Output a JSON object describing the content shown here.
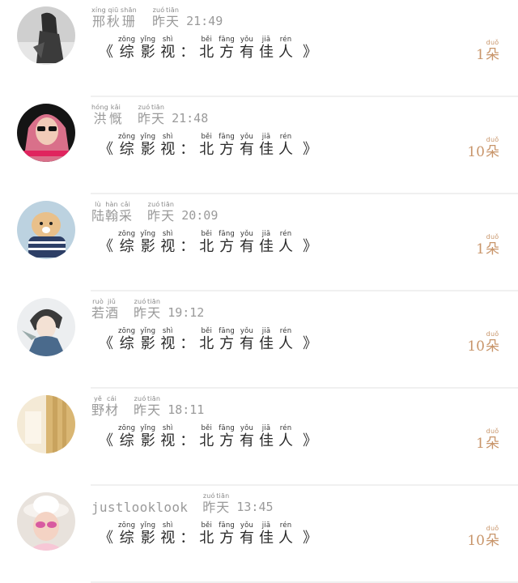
{
  "colors": {
    "text_gray": "#9a9a9a",
    "text_dark": "#2a2a2a",
    "amount_accent": "#c8956a",
    "divider": "#f0f0f0"
  },
  "shared": {
    "day_label": {
      "pinyin": [
        "zuó",
        "tiān"
      ],
      "chars": [
        "昨",
        "天"
      ]
    },
    "title": {
      "open": "《",
      "close": "》",
      "colon": "：",
      "chars1": [
        {
          "py": "zōng",
          "ch": "综"
        },
        {
          "py": "yǐng",
          "ch": "影"
        },
        {
          "py": "shì",
          "ch": "视"
        }
      ],
      "chars2": [
        {
          "py": "běi",
          "ch": "北"
        },
        {
          "py": "fāng",
          "ch": "方"
        },
        {
          "py": "yǒu",
          "ch": "有"
        },
        {
          "py": "jiā",
          "ch": "佳"
        },
        {
          "py": "rén",
          "ch": "人"
        }
      ]
    },
    "unit": {
      "py": "duǒ",
      "ch": "朵"
    }
  },
  "rows": [
    {
      "avatar_icon": "avatar-girl-gray-icon",
      "name_chars": [
        {
          "py": "xíng",
          "ch": "邢"
        },
        {
          "py": "qiū",
          "ch": "秋"
        },
        {
          "py": "shān",
          "ch": "珊"
        }
      ],
      "time": "21:49",
      "amount": "1"
    },
    {
      "avatar_icon": "avatar-girl-sunglasses-icon",
      "name_chars": [
        {
          "py": "hóng",
          "ch": "洪"
        },
        {
          "py": "kǎi",
          "ch": "慨"
        }
      ],
      "time": "21:48",
      "amount": "10"
    },
    {
      "avatar_icon": "avatar-dog-icon",
      "name_chars": [
        {
          "py": "lù",
          "ch": "陆"
        },
        {
          "py": "hàn",
          "ch": "翰"
        },
        {
          "py": "cǎi",
          "ch": "采"
        }
      ],
      "time": "20:09",
      "amount": "1"
    },
    {
      "avatar_icon": "avatar-anime-boy-icon",
      "name_chars": [
        {
          "py": "ruò",
          "ch": "若"
        },
        {
          "py": "jiǔ",
          "ch": "酒"
        }
      ],
      "time": "19:12",
      "amount": "10"
    },
    {
      "avatar_icon": "avatar-curtain-icon",
      "name_chars": [
        {
          "py": "yě",
          "ch": "野"
        },
        {
          "py": "cái",
          "ch": "材"
        }
      ],
      "time": "18:11",
      "amount": "1"
    },
    {
      "avatar_icon": "avatar-child-hat-icon",
      "name_latin": "justlooklook",
      "time": "13:45",
      "amount": "10"
    }
  ]
}
